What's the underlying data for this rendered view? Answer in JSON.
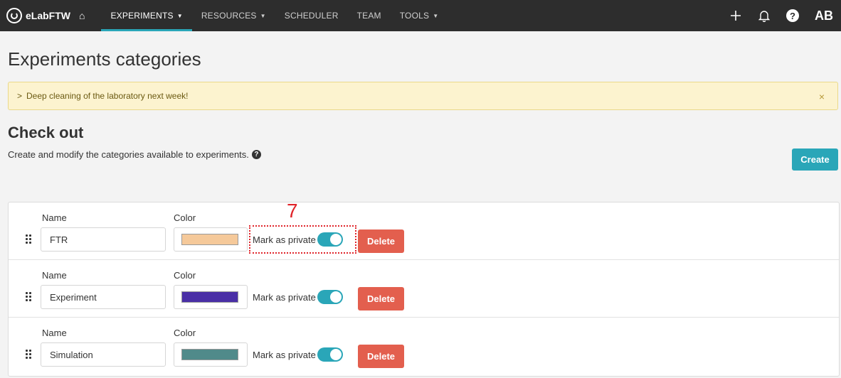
{
  "nav": {
    "brand": "eLabFTW",
    "items": [
      {
        "label": "EXPERIMENTS",
        "dropdown": true,
        "active": true
      },
      {
        "label": "RESOURCES",
        "dropdown": true,
        "active": false
      },
      {
        "label": "SCHEDULER",
        "dropdown": false,
        "active": false
      },
      {
        "label": "TEAM",
        "dropdown": false,
        "active": false
      },
      {
        "label": "TOOLS",
        "dropdown": true,
        "active": false
      }
    ],
    "avatar": "AB"
  },
  "page": {
    "title": "Experiments categories"
  },
  "alert": {
    "text": "Deep cleaning of the laboratory next week!",
    "close": "×"
  },
  "section": {
    "title": "Check out",
    "description": "Create and modify the categories available to experiments.",
    "create_label": "Create"
  },
  "categories": [
    {
      "name_label": "Name",
      "color_label": "Color",
      "name": "FTR",
      "color": "#f5c99a",
      "private_label": "Mark as private",
      "private": true,
      "delete_label": "Delete"
    },
    {
      "name_label": "Name",
      "color_label": "Color",
      "name": "Experiment",
      "color": "#4a2fa6",
      "private_label": "Mark as private",
      "private": true,
      "delete_label": "Delete"
    },
    {
      "name_label": "Name",
      "color_label": "Color",
      "name": "Simulation",
      "color": "#508a8a",
      "private_label": "Mark as private",
      "private": true,
      "delete_label": "Delete"
    }
  ],
  "annotation": {
    "marker": "7"
  },
  "colors": {
    "accent": "#2aa6b8",
    "danger": "#e35f4e",
    "navbar": "#2d2d2d"
  }
}
